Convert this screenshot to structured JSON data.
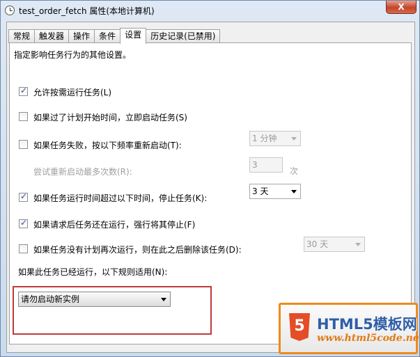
{
  "window": {
    "title": "test_order_fetch 属性(本地计算机)",
    "close_label": "X"
  },
  "tabs": [
    {
      "label": "常规",
      "active": false
    },
    {
      "label": "触发器",
      "active": false
    },
    {
      "label": "操作",
      "active": false
    },
    {
      "label": "条件",
      "active": false
    },
    {
      "label": "设置",
      "active": true
    },
    {
      "label": "历史记录(已禁用)",
      "active": false
    }
  ],
  "settings": {
    "description": "指定影响任务行为的其他设置。",
    "allow_on_demand": {
      "label": "允许按需运行任务(L)",
      "checked": true
    },
    "run_missed": {
      "label": "如果过了计划开始时间，立即启动任务(S)",
      "checked": false
    },
    "restart_on_fail": {
      "label": "如果任务失败，按以下频率重新启动(T):",
      "checked": false,
      "interval": "1 分钟"
    },
    "restart_attempts": {
      "label": "尝试重新启动最多次数(R):",
      "value": "3",
      "unit": "次"
    },
    "stop_if_long": {
      "label": "如果任务运行时间超过以下时间，停止任务(K):",
      "checked": true,
      "duration": "3 天"
    },
    "force_stop": {
      "label": "如果请求后任务还在运行，强行将其停止(F)",
      "checked": true
    },
    "delete_if_not_scheduled": {
      "label": "如果任务没有计划再次运行，则在此之后删除该任务(D):",
      "checked": false,
      "duration": "30 天"
    },
    "already_running": {
      "label": "如果此任务已经运行，以下规则适用(N):",
      "value": "请勿启动新实例"
    }
  },
  "watermark": {
    "badge": "5",
    "title": "HTML5模板网",
    "url": "www.html5code.net"
  },
  "colors": {
    "highlight_border": "#c0393b",
    "watermark_orange": "#f08a1c",
    "watermark_blue": "#2f5ea8"
  }
}
